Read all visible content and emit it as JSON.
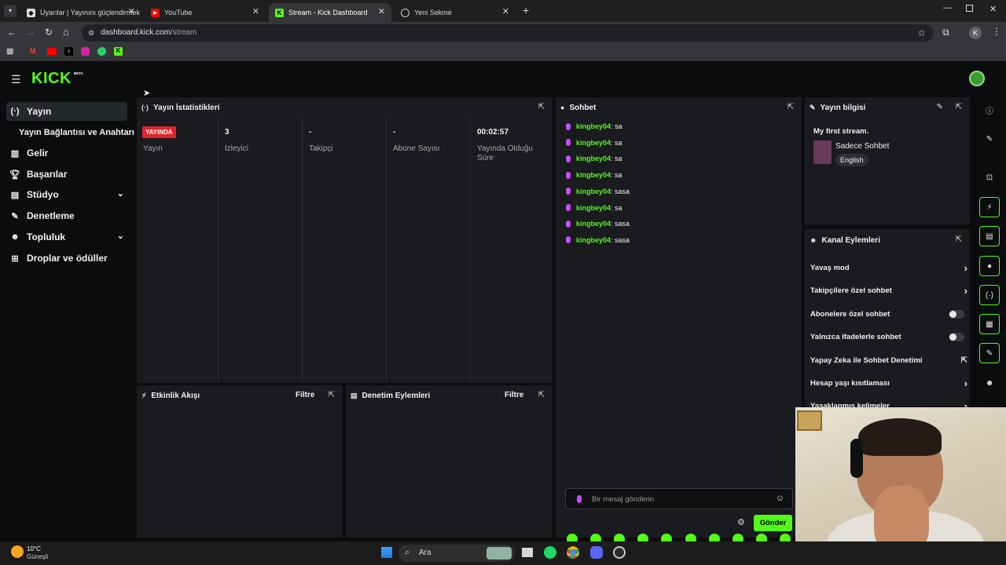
{
  "browser": {
    "tabs": [
      {
        "label": "Uyarılar | Yayınını güçlendirmek",
        "active": false,
        "favicon": "kick-shield-icon"
      },
      {
        "label": "YouTube",
        "active": false,
        "favicon": "youtube-icon"
      },
      {
        "label": "Stream - Kick Dashboard",
        "active": true,
        "favicon": "kick-icon"
      },
      {
        "label": "Yeni Sekme",
        "active": false,
        "favicon": "globe-icon"
      }
    ],
    "url_host": "dashboard.kick.com",
    "url_path": "/stream",
    "profile_initial": "K",
    "add_tab": "+"
  },
  "brand": {
    "logo": "KICK",
    "beta": "BETA"
  },
  "nav": {
    "items": [
      {
        "label": "Yayın",
        "icon": "broadcast-icon",
        "active": true
      },
      {
        "label": "Yayın Bağlantısı ve Anahtarı",
        "icon": "",
        "active": false
      },
      {
        "label": "Gelir",
        "icon": "chart-icon",
        "active": false
      },
      {
        "label": "Başarılar",
        "icon": "trophy-icon",
        "active": false
      },
      {
        "label": "Stüdyo",
        "icon": "studio-icon",
        "active": false
      },
      {
        "label": "Denetleme",
        "icon": "wrench-icon",
        "active": false
      },
      {
        "label": "Topluluk",
        "icon": "people-icon",
        "active": false
      },
      {
        "label": "Droplar ve ödüller",
        "icon": "gift-icon",
        "active": false
      }
    ]
  },
  "stats": {
    "title": "Yayın İstatistikleri",
    "live_badge": "YAYINDA",
    "columns": [
      {
        "value": "",
        "label": "Yayın"
      },
      {
        "value": "3",
        "label": "İzleyici"
      },
      {
        "value": "-",
        "label": "Takipçi"
      },
      {
        "value": "-",
        "label": "Abone Sayısı"
      },
      {
        "value": "00:02:57",
        "label": "Yayında Olduğu Süre"
      }
    ]
  },
  "activity": {
    "title": "Etkinlik Akışı",
    "filter": "Filtre"
  },
  "moderation": {
    "title": "Denetim Eylemleri",
    "filter": "Filtre"
  },
  "chat": {
    "title": "Sohbet",
    "messages": [
      {
        "user": "kingbey04",
        "text": ": sa"
      },
      {
        "user": "kingbey04",
        "text": ": sa"
      },
      {
        "user": "kingbey04",
        "text": ": sa"
      },
      {
        "user": "kingbey04",
        "text": ": sa"
      },
      {
        "user": "kingbey04",
        "text": ": sasa"
      },
      {
        "user": "kingbey04",
        "text": ": sa"
      },
      {
        "user": "kingbey04",
        "text": ": sasa"
      },
      {
        "user": "kingbey04",
        "text": ": sasa"
      }
    ],
    "input_placeholder": "Bir mesaj gönderin",
    "send_label": "Gönder"
  },
  "stream_info": {
    "title": "Yayın bilgisi",
    "stream_title": "My first stream.",
    "category": "Sadece Sohbet",
    "language": "English"
  },
  "channel_actions": {
    "title": "Kanal Eylemleri",
    "items": [
      {
        "label": "Yavaş mod",
        "control": "chevron"
      },
      {
        "label": "Takipçilere özel sohbet",
        "control": "chevron"
      },
      {
        "label": "Abonelere özel sohbet",
        "control": "toggle",
        "on": false
      },
      {
        "label": "Yalnızca ifadelerle sohbet",
        "control": "toggle",
        "on": false
      },
      {
        "label": "Yapay Zeka ile Sohbet Denetimi",
        "control": "external"
      },
      {
        "label": "Hesap yaşı kısıtlaması",
        "control": "chevron"
      },
      {
        "label": "Yasaklanmış kelimeler",
        "control": "chevron"
      }
    ]
  },
  "taskbar": {
    "weather_temp": "10°C",
    "weather_desc": "Güneşli",
    "search_label": "Ara"
  },
  "colors": {
    "accent": "#53fc18",
    "live": "#e0242b",
    "panel": "#191b1f",
    "background": "#0b0c0d"
  }
}
